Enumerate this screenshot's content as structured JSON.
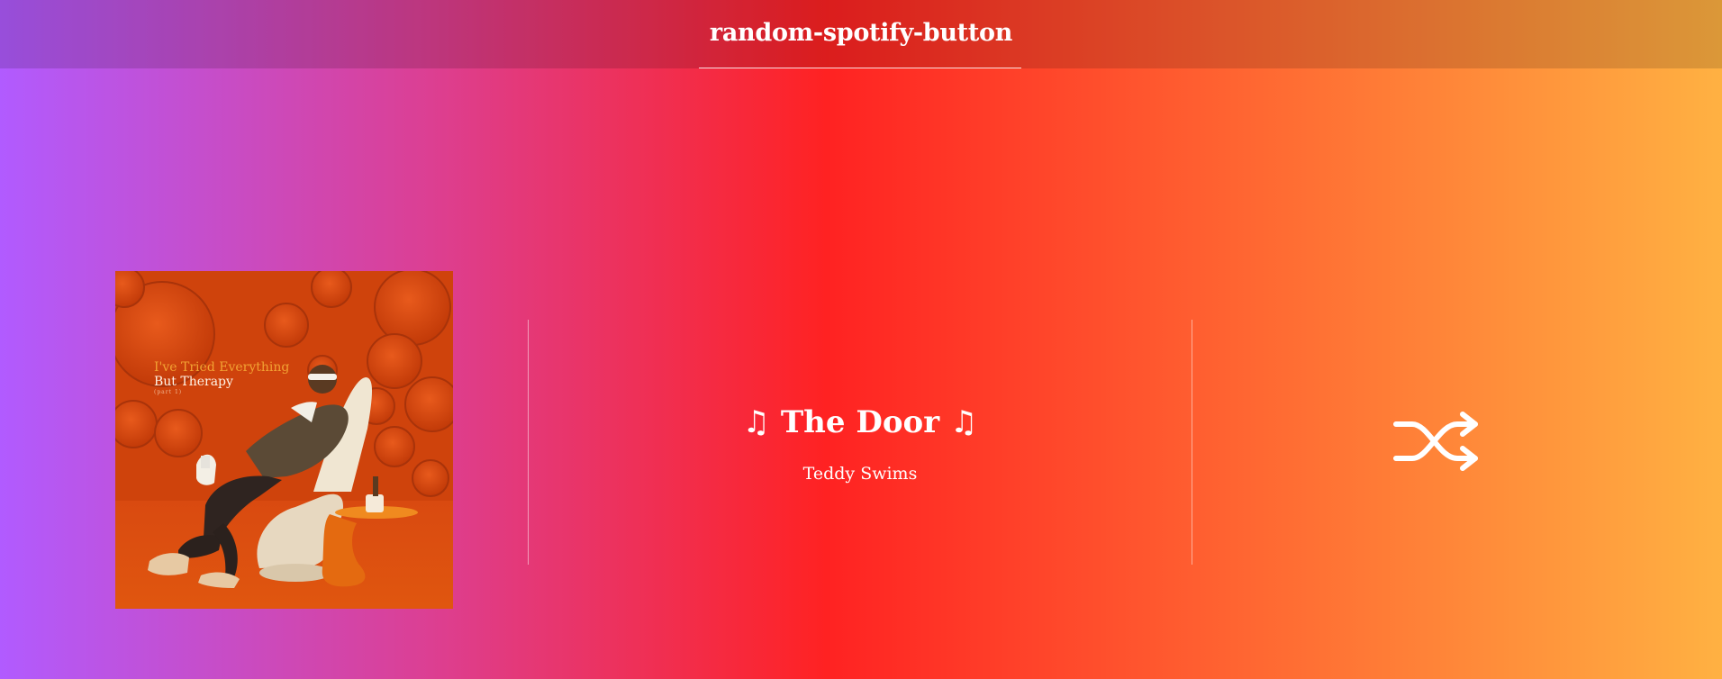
{
  "app": {
    "title": "random-spotify-button"
  },
  "track": {
    "note_symbol": "♫",
    "title": "The Door",
    "artist": "Teddy Swims",
    "album_art": {
      "line1": "I've Tried Everything",
      "line2": "But Therapy",
      "line3": "(part 1)"
    }
  },
  "controls": {
    "shuffle_icon": "shuffle-icon"
  },
  "colors": {
    "gradient": [
      "#b15bff",
      "#dc3f92",
      "#ff2222",
      "#ff5a2f",
      "#ffb142"
    ],
    "text": "#ffffff",
    "cover_background": "#d8470e"
  }
}
